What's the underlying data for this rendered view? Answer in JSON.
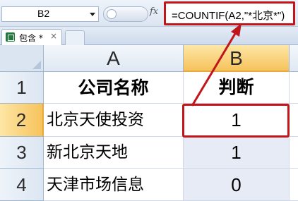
{
  "formula_bar": {
    "name_box": "B2",
    "fx": "fx",
    "formula": "=COUNTIF(A2,\"*北京*\")"
  },
  "tabs": {
    "active_tab": "包含 *",
    "close": "×"
  },
  "sheet": {
    "columns": [
      "A",
      "B"
    ],
    "rows": [
      {
        "num": "1",
        "a": "公司名称",
        "b": "判断"
      },
      {
        "num": "2",
        "a": "北京天使投资",
        "b": "1"
      },
      {
        "num": "3",
        "a": "新北京天地",
        "b": "1"
      },
      {
        "num": "4",
        "a": "天津市场信息",
        "b": "0"
      }
    ],
    "selected_cell": "B2"
  },
  "colors": {
    "annotation_red": "#c0161b",
    "selected_header": "#f6c35c"
  }
}
